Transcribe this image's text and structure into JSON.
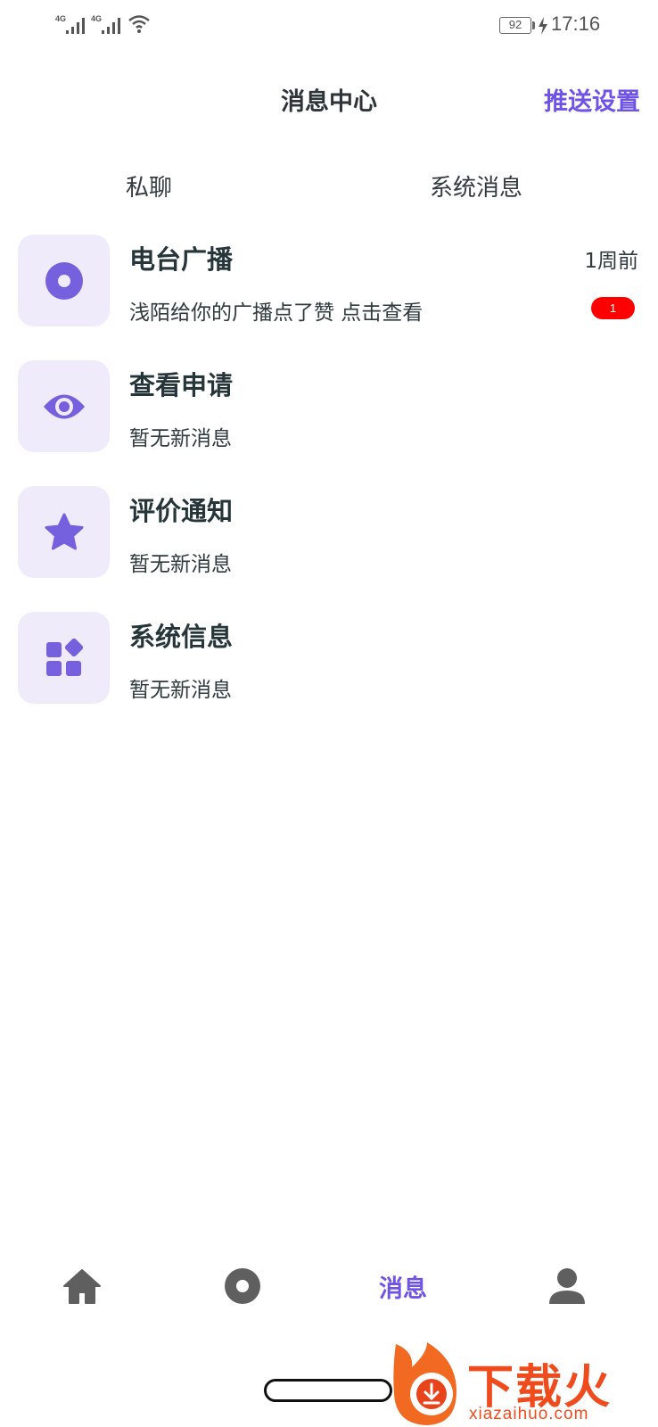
{
  "status_bar": {
    "signal_1_label": "4G",
    "signal_2_label": "4G",
    "battery": "92",
    "time": "17:16"
  },
  "header": {
    "title": "消息中心",
    "push_settings": "推送设置"
  },
  "tabs": [
    {
      "label": "私聊"
    },
    {
      "label": "系统消息"
    }
  ],
  "messages": [
    {
      "icon": "radio-disc-icon",
      "title": "电台广播",
      "subtitle": "浅陌给你的广播点了赞 点击查看",
      "time": "1周前",
      "badge": "1"
    },
    {
      "icon": "eye-icon",
      "title": "查看申请",
      "subtitle": "暂无新消息"
    },
    {
      "icon": "star-icon",
      "title": "评价通知",
      "subtitle": "暂无新消息"
    },
    {
      "icon": "apps-grid-icon",
      "title": "系统信息",
      "subtitle": "暂无新消息"
    }
  ],
  "bottom_nav": {
    "home_icon": "home-icon",
    "radio_icon": "radio-icon",
    "messages_label": "消息",
    "profile_icon": "profile-icon"
  },
  "watermark": {
    "text": "下载火",
    "url": "xiazaihuo.com"
  },
  "colors": {
    "accent": "#6e53e6",
    "icon_bg": "#efebfb",
    "badge": "#ff0000",
    "watermark": "#f04b1c"
  }
}
